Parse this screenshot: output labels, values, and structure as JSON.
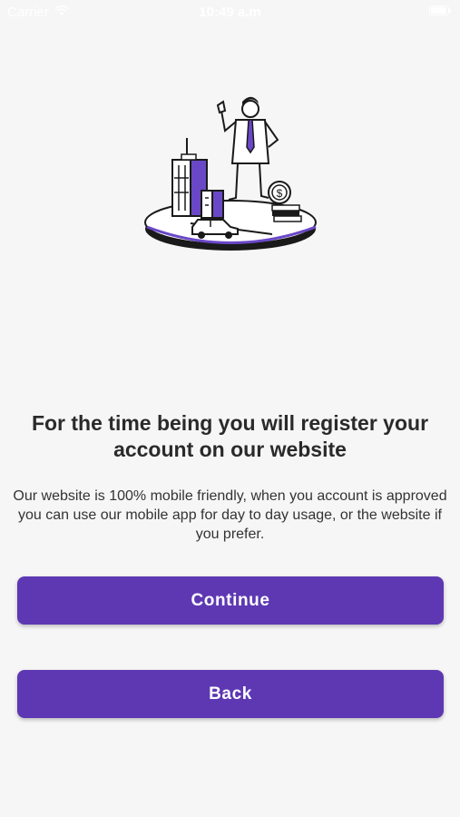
{
  "status_bar": {
    "carrier": "Carrier",
    "time": "10:49 a.m",
    "wifi_icon": "wifi-icon",
    "battery_icon": "battery-icon"
  },
  "illustration": {
    "icon": "businessman-city-illustration",
    "accent_color": "#6a47c7"
  },
  "content": {
    "title": "For the time being you will register your account on our website",
    "body": "Our website is 100% mobile friendly, when you account is approved you can use our mobile app for day to day usage, or the website if you prefer."
  },
  "buttons": {
    "continue_label": "Continue",
    "back_label": "Back",
    "color": "#5e38b3"
  }
}
